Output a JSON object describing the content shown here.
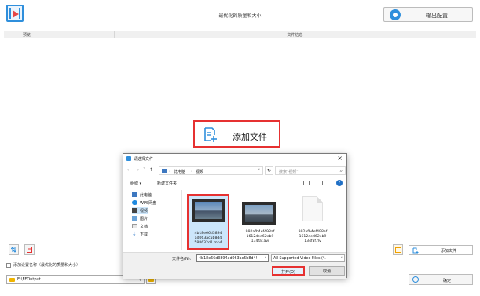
{
  "app": {
    "title": "最优化的质量和大小",
    "output_config_label": "输出配置"
  },
  "list": {
    "col_preview": "预览",
    "col_info": "文件信息"
  },
  "add_file": {
    "central_label": "添加文件",
    "small_label": "添加文件"
  },
  "bottom": {
    "checkbox_label": "添加设置名称（最优化的质量和大小）",
    "output_path": "E:\\FFOutput",
    "confirm_label": "确定"
  },
  "dialog": {
    "title": "请选择文件",
    "address": {
      "seg1": "此电脑",
      "seg2": "视频",
      "search_placeholder": "搜索\"视频\""
    },
    "toolbar": {
      "organize": "组织 ▾",
      "new_folder": "新建文件夹"
    },
    "nav_items": [
      "此电脑",
      "WPS网盘",
      "视频",
      "图片",
      "文档",
      "下载"
    ],
    "files": [
      {
        "name_lines": [
          "4b18e66d3894",
          "ad063ac5b8d4",
          "588632d1.mp4"
        ],
        "selected": true,
        "kind": "video"
      },
      {
        "name_lines": [
          "992afb4ef498af",
          "1612ded62eb9",
          "134faf.avi"
        ],
        "selected": false,
        "kind": "video"
      },
      {
        "name_lines": [
          "992afb4ef498af",
          "1612ded62eb9",
          "134faf.flv"
        ],
        "selected": false,
        "kind": "document"
      }
    ],
    "filename_label": "文件名(N):",
    "filename_value": "4b18e66d3894ad063ac5b8d4!",
    "filetype_value": "All Supported Video Files (*.",
    "open_label": "打开(O)",
    "cancel_label": "取消"
  },
  "colors": {
    "accent": "#2f8fdc",
    "highlight_red": "#e63131",
    "folder_yellow": "#f0b400"
  }
}
